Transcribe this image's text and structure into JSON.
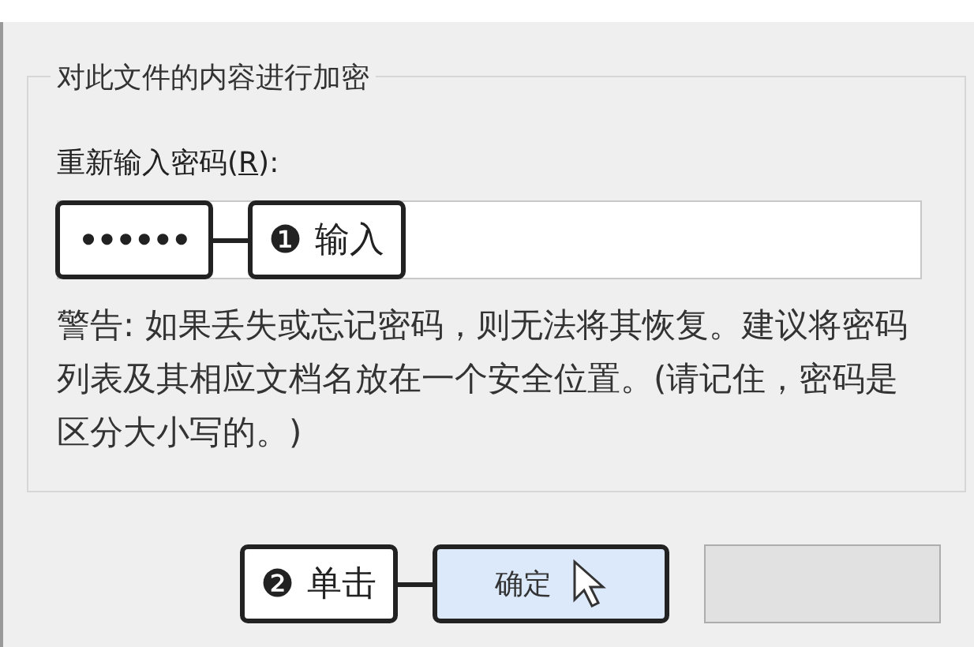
{
  "group": {
    "title": "对此文件的内容进行加密"
  },
  "password": {
    "label_before": "重新输入密码(",
    "access_key": "R",
    "label_after": "):",
    "value": "••••••"
  },
  "callouts": [
    {
      "number": "❶",
      "text": "输入"
    },
    {
      "number": "❷",
      "text": "单击"
    }
  ],
  "warning": "警告: 如果丢失或忘记密码，则无法将其恢复。建议将密码列表及其相应文档名放在一个安全位置。(请记住，密码是区分大小写的。)",
  "buttons": [
    {
      "kind": "ok",
      "label": "确定",
      "highlighted": true
    },
    {
      "kind": "cancel",
      "highlighted": false
    }
  ]
}
